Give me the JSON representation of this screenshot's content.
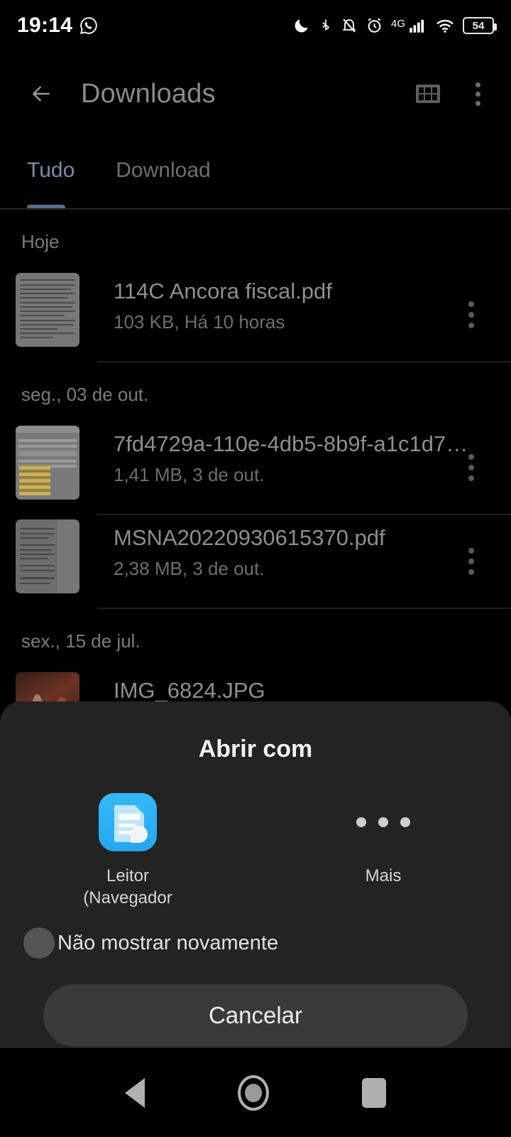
{
  "status_bar": {
    "time": "19:14",
    "left_icons": [
      "whatsapp-icon"
    ],
    "right_icons": [
      "dnd-moon-icon",
      "bluetooth-icon",
      "ringer-off-icon",
      "alarm-icon",
      "mobile-signal-icon",
      "wifi-icon"
    ],
    "network_type": "4G",
    "battery_level": "54"
  },
  "app_bar": {
    "back_label": "back-arrow",
    "title": "Downloads",
    "grid_label": "grid-view",
    "overflow_label": "more-options"
  },
  "tabs": {
    "items": [
      {
        "label": "Tudo",
        "active": true
      },
      {
        "label": "Download",
        "active": false
      }
    ]
  },
  "list": {
    "sections": [
      {
        "header": "Hoje",
        "items": [
          {
            "name": "114C Ancora fiscal.pdf",
            "meta": "103 KB, Há 10 horas",
            "thumb": "doc-a"
          }
        ]
      },
      {
        "header": "seg., 03 de out.",
        "items": [
          {
            "name": "7fd4729a-110e-4db5-8b9f-a1c1d7…",
            "meta": "1,41 MB, 3 de out.",
            "thumb": "sheet"
          },
          {
            "name": "MSNA20220930615370.pdf",
            "meta": "2,38 MB, 3 de out.",
            "thumb": "doc-c"
          }
        ]
      },
      {
        "header": "sex., 15 de jul.",
        "items": [
          {
            "name": "IMG_6824.JPG",
            "meta": "",
            "thumb": "photo"
          }
        ]
      }
    ]
  },
  "dialog": {
    "title": "Abrir com",
    "apps": [
      {
        "label": "Leitor\n(Navegador",
        "label_line1": "Leitor",
        "label_line2": "(Navegador",
        "icon": "document-reader-icon"
      },
      {
        "label": "Mais",
        "icon": "more-dots-icon"
      }
    ],
    "checkbox_label": "Não mostrar novamente",
    "checkbox_checked": false,
    "cancel_label": "Cancelar"
  },
  "nav_bar": {
    "back": "back-triangle",
    "home": "home-circle",
    "recents": "recents-square"
  },
  "colors": {
    "background": "#000000",
    "dialog_bg": "#232323",
    "accent_tab": "#7d8ba6",
    "app_icon_blue": "#35b9fb"
  }
}
